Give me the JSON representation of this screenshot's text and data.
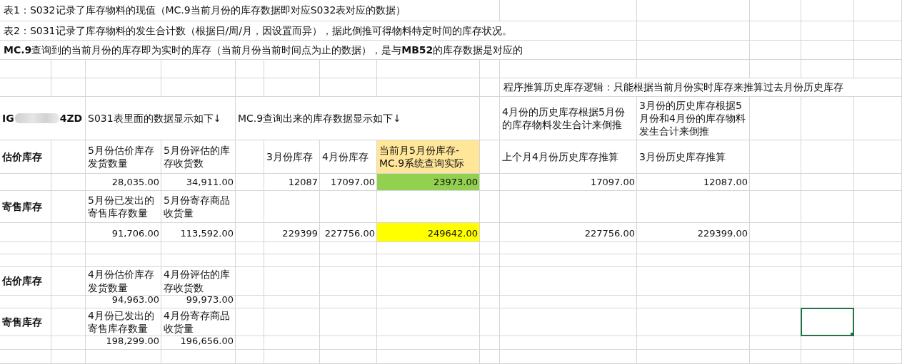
{
  "notes": [
    "表1：S032记录了库存物料的现值（MC.9当前月份的库存数据即对应S032表对应的数据）",
    "表2：S031记录了库存物料的发生合计数（根据日/周/月，因设置而异），据此倒推可得物料特定时间的库存状况。",
    "**MC.9**查询到的当前月份的库存即为实时的库存（当前月份当前时间点为止的数据），是与**MB52**的库存数据是对应的"
  ],
  "logic_note": "程序推算历史库存逻辑：只能根据当前月份实时库存来推算过去月份历史库存",
  "material_id": {
    "prefix": "IG",
    "suffix": "4ZD"
  },
  "s031": {
    "heading": "S031表里面的数据显示如下↓",
    "groups": [
      {
        "label": "估价库存",
        "headers": [
          "5月份估价库存发货数量",
          "5月份评估的库存收货数"
        ],
        "values": [
          "28,035.00",
          "34,911.00"
        ]
      },
      {
        "label": "寄售库存",
        "headers": [
          "5月份已发出的寄售库存数量",
          "5月份寄存商品收货量"
        ],
        "values": [
          "91,706.00",
          "113,592.00"
        ]
      },
      {
        "label": "估价库存",
        "headers": [
          "4月份估价库存发货数量",
          "4月份评估的库存收货数"
        ],
        "values": [
          "94,963.00",
          "99,973.00"
        ]
      },
      {
        "label": "寄售库存",
        "headers": [
          "4月份已发出的寄售库存数量",
          "4月份寄存商品收货量"
        ],
        "values": [
          "198,299.00",
          "196,656.00"
        ]
      }
    ]
  },
  "mc9": {
    "heading": "MC.9查询出来的库存数据显示如下↓",
    "headers": [
      {
        "text": "3月份库存"
      },
      {
        "text": "4月份库存"
      },
      {
        "text": "当前月5月份库存-MC.9系统查询实际",
        "color": "#ffe699"
      }
    ],
    "rows": [
      {
        "values": [
          "12087",
          "17097.00"
        ],
        "current": "23973.00",
        "color": "#92d050"
      },
      {
        "values": [
          "229399",
          "227756.00"
        ],
        "current": "249642.00",
        "color": "#ffff00"
      }
    ]
  },
  "back_calc": {
    "notes": [
      "4月份的历史库存根据5月份的库存物料发生合计来倒推",
      "3月份的历史库存根据5月份和4月份的库存物料发生合计来倒推"
    ],
    "headers": [
      "上个月4月份历史库存推算",
      "3月份历史库存推算"
    ],
    "rows": [
      [
        "17097.00",
        "12087.00"
      ],
      [
        "227756.00",
        "229399.00"
      ]
    ]
  },
  "active_cell": {
    "selected": true
  }
}
